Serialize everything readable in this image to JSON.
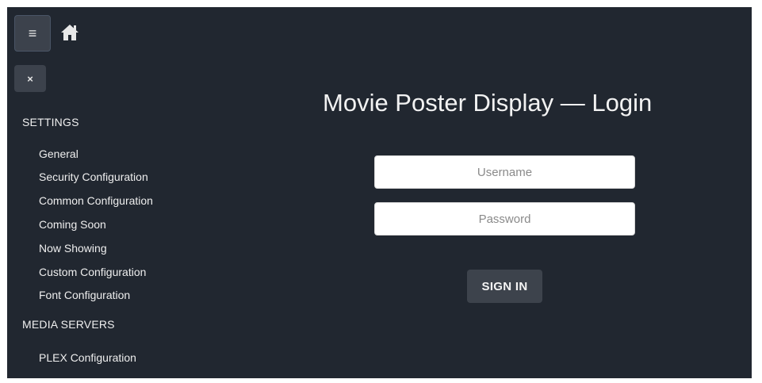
{
  "topbar": {
    "menu_icon": "hamburger-icon",
    "menu_glyph": "≡",
    "home_icon": "home-icon"
  },
  "sidebar": {
    "close_icon": "close-icon",
    "close_glyph": "×",
    "sections": [
      {
        "heading": "SETTINGS",
        "items": [
          "General",
          "Security Configuration",
          "Common Configuration",
          "Coming Soon",
          "Now Showing",
          "Custom Configuration",
          "Font Configuration"
        ]
      },
      {
        "heading": "MEDIA SERVERS",
        "items": [
          "PLEX Configuration"
        ]
      }
    ]
  },
  "login": {
    "title": "Movie Poster Display — Login",
    "username_placeholder": "Username",
    "username_value": "",
    "password_placeholder": "Password",
    "password_value": "",
    "signin_label": "SIGN IN"
  },
  "colors": {
    "background": "#212730",
    "button": "#3c424c",
    "text": "#f2f2f2"
  }
}
